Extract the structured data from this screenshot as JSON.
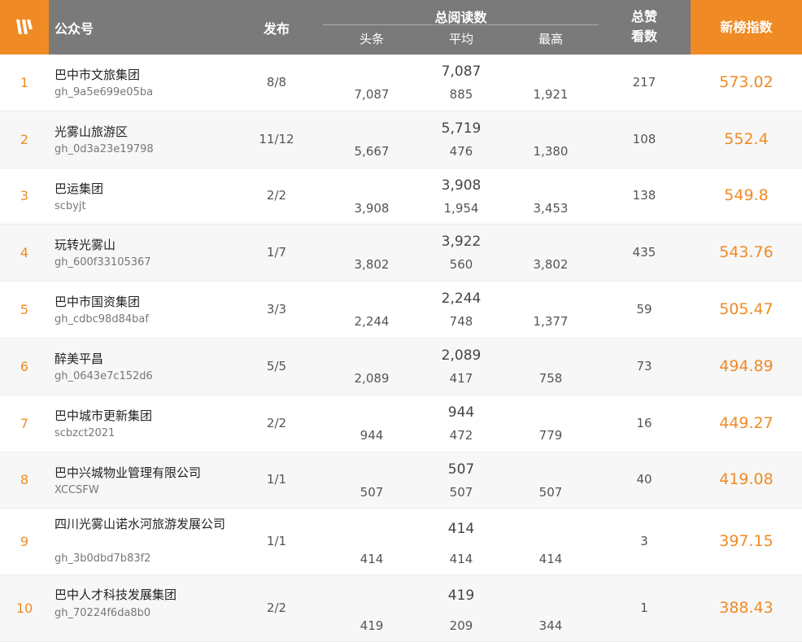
{
  "header": {
    "account": "公众号",
    "publish": "发布",
    "reads_group": "总阅读数",
    "reads_head": "头条",
    "reads_avg": "平均",
    "reads_max": "最高",
    "likes_line1": "总赞",
    "likes_line2": "看数",
    "index": "新榜指数"
  },
  "rows": [
    {
      "rank": "1",
      "name": "巴中市文旅集团",
      "account": "gh_9a5e699e05ba",
      "publish": "8/8",
      "total": "7,087",
      "head": "7,087",
      "avg": "885",
      "max": "1,921",
      "likes": "217",
      "index": "573.02"
    },
    {
      "rank": "2",
      "name": "光雾山旅游区",
      "account": "gh_0d3a23e19798",
      "publish": "11/12",
      "total": "5,719",
      "head": "5,667",
      "avg": "476",
      "max": "1,380",
      "likes": "108",
      "index": "552.4"
    },
    {
      "rank": "3",
      "name": "巴运集团",
      "account": "scbyjt",
      "publish": "2/2",
      "total": "3,908",
      "head": "3,908",
      "avg": "1,954",
      "max": "3,453",
      "likes": "138",
      "index": "549.8"
    },
    {
      "rank": "4",
      "name": "玩转光雾山",
      "account": "gh_600f33105367",
      "publish": "1/7",
      "total": "3,922",
      "head": "3,802",
      "avg": "560",
      "max": "3,802",
      "likes": "435",
      "index": "543.76"
    },
    {
      "rank": "5",
      "name": "巴中市国资集团",
      "account": "gh_cdbc98d84baf",
      "publish": "3/3",
      "total": "2,244",
      "head": "2,244",
      "avg": "748",
      "max": "1,377",
      "likes": "59",
      "index": "505.47"
    },
    {
      "rank": "6",
      "name": "醉美平昌",
      "account": "gh_0643e7c152d6",
      "publish": "5/5",
      "total": "2,089",
      "head": "2,089",
      "avg": "417",
      "max": "758",
      "likes": "73",
      "index": "494.89"
    },
    {
      "rank": "7",
      "name": "巴中城市更新集团",
      "account": "scbzct2021",
      "publish": "2/2",
      "total": "944",
      "head": "944",
      "avg": "472",
      "max": "779",
      "likes": "16",
      "index": "449.27"
    },
    {
      "rank": "8",
      "name": "巴中兴城物业管理有限公司",
      "account": "XCCSFW",
      "publish": "1/1",
      "total": "507",
      "head": "507",
      "avg": "507",
      "max": "507",
      "likes": "40",
      "index": "419.08"
    },
    {
      "rank": "9",
      "name": "四川光雾山诺水河旅游发展公司",
      "account": "gh_3b0dbd7b83f2",
      "publish": "1/1",
      "total": "414",
      "head": "414",
      "avg": "414",
      "max": "414",
      "likes": "3",
      "index": "397.15"
    },
    {
      "rank": "10",
      "name": "巴中人才科技发展集团",
      "account": "gh_70224f6da8b0",
      "publish": "2/2",
      "total": "419",
      "head": "419",
      "avg": "209",
      "max": "344",
      "likes": "1",
      "index": "388.43"
    }
  ]
}
